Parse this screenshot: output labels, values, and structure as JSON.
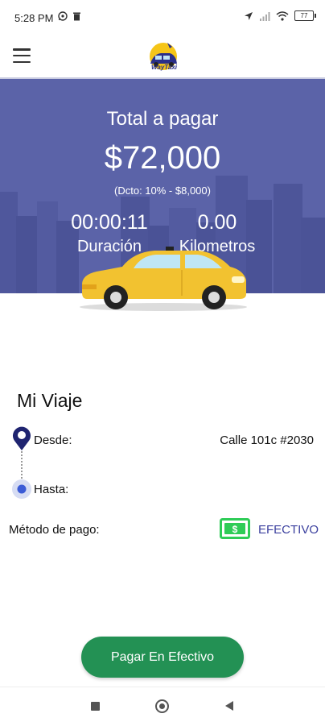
{
  "status_bar": {
    "time": "5:28 PM",
    "battery": "77"
  },
  "hero": {
    "total_label": "Total a pagar",
    "total_amount": "$72,000",
    "discount": "(Dcto: 10% -  $8,000)",
    "duration_value": "00:00:11",
    "duration_label": "Duración",
    "distance_value": "0.00",
    "distance_label": "Kilometros"
  },
  "trip": {
    "title": "Mi Viaje",
    "from_label": "Desde:",
    "from_value": "Calle 101c #2030",
    "to_label": "Hasta:",
    "to_value": "",
    "payment_label": "Método de pago:",
    "payment_value": "EFECTIVO"
  },
  "actions": {
    "pay_button": "Pagar En Efectivo"
  },
  "colors": {
    "hero_bg": "#5b63a8",
    "pay_button": "#239154",
    "accent": "#3a3f9e",
    "cash_green": "#2ecc57"
  },
  "icons": {
    "menu": "menu-icon",
    "origin": "location-pin-icon",
    "destination": "destination-dot-icon",
    "payment": "cash-icon"
  }
}
